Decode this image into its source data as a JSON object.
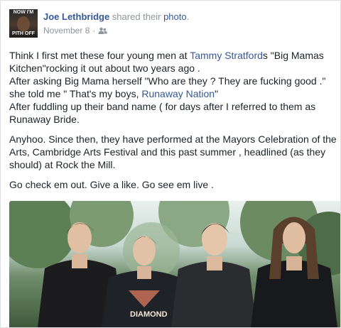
{
  "post": {
    "avatar_caption_top": "NOW I'M",
    "avatar_caption_bottom": "PITH OFF",
    "author": "Joe Lethbridge",
    "action": " shared their ",
    "object": "photo",
    "object_suffix": ".",
    "date": "November 8",
    "meta_separator": "·",
    "privacy_icon": "friends-icon"
  },
  "body": {
    "p1_a": "Think I first met these four young men at ",
    "p1_link": "Tammy Stratford",
    "p1_b": "s \"Big Mamas Kitchen\"rocking it out about two years ago .",
    "p1_c": "After asking Big Mama herself \"Who are they ? They are fucking good .\" she told me \" That's my boys, ",
    "p1_link2": "Runaway Nation",
    "p1_d": "\"",
    "p1_e": "After fuddling up their band name ( for days after I referred to them as Runaway Bride.",
    "p2": "Anyhoo. Since then, they have performed at the Mayors Celebration of the Arts, Cambridge Arts Festival and this past summer , headlined (as they should) at Rock the Mill.",
    "p3": "Go check em out. Give a like. Go see em live ."
  },
  "photo": {
    "shirt_text": "DIAMOND"
  },
  "colors": {
    "link": "#365899",
    "text": "#1d2129",
    "meta": "#90949c"
  }
}
